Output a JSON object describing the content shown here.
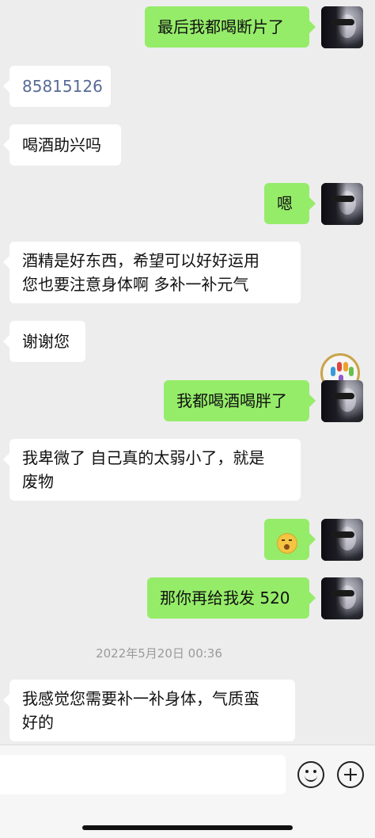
{
  "messages": [
    {
      "side": "right",
      "text": "最后我都喝断片了"
    },
    {
      "side": "left",
      "text": "85815126"
    },
    {
      "side": "left",
      "text": "喝酒助兴吗"
    },
    {
      "side": "right",
      "text": "嗯"
    },
    {
      "side": "left",
      "line1": "酒精是好东西，希望可以好好运用",
      "line2": "您也要注意身体啊 多补一补元气"
    },
    {
      "side": "left",
      "text": "谢谢您"
    },
    {
      "side": "right",
      "text": "我都喝酒喝胖了"
    },
    {
      "side": "left",
      "line1": "我卑微了 自己真的太弱小了，就是",
      "line2": "废物"
    },
    {
      "side": "right",
      "emoji": "face-emoji"
    },
    {
      "side": "right",
      "text": "那你再给我发 520"
    },
    {
      "side": "left",
      "line1": "我感觉您需要补一补身体，气质蛮",
      "line2": "好的"
    }
  ],
  "timestamp": "2022年5月20日 00:36",
  "colors": {
    "background": "#ededed",
    "sent_bubble": "#95ec69",
    "received_bubble": "#ffffff",
    "number_link": "#576b95"
  },
  "input_bar": {
    "emoji_icon": "smiley-icon",
    "add_icon": "plus-circle-icon"
  }
}
